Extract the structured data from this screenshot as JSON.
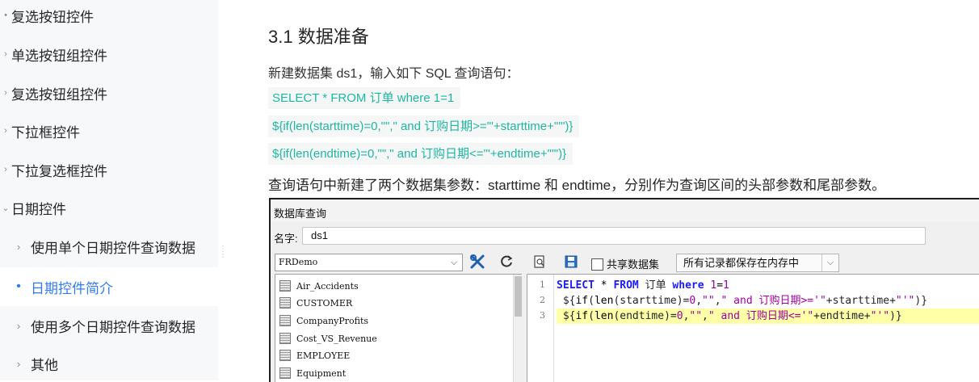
{
  "sidebar": {
    "items": [
      {
        "label": "复选按钮控件"
      },
      {
        "label": "单选按钮组控件"
      },
      {
        "label": "复选按钮组控件"
      },
      {
        "label": "下拉框控件"
      },
      {
        "label": "下拉复选框控件"
      },
      {
        "label": "日期控件"
      }
    ],
    "children": [
      {
        "label": "使用单个日期控件查询数据"
      },
      {
        "label": "日期控件简介"
      },
      {
        "label": "使用多个日期控件查询数据"
      },
      {
        "label": "其他"
      }
    ],
    "active_child": "日期控件简介"
  },
  "article": {
    "section_title": "3.1 数据准备",
    "intro": "新建数据集 ds1，输入如下 SQL 查询语句：",
    "code": [
      "SELECT * FROM 订单 where 1=1",
      " ${if(len(starttime)=0,\"\",\" and 订购日期>='\"+starttime+\"'\")}",
      " ${if(len(endtime)=0,\"\",\" and 订购日期<='\"+endtime+\"'\")}"
    ],
    "param_desc": "查询语句中新建了两个数据集参数：starttime 和 endtime，分别作为查询区间的头部参数和尾部参数。"
  },
  "dialog": {
    "title": "数据库查询",
    "name_label": "名字:",
    "name_value": "ds1",
    "datasource": "FRDemo",
    "tables": [
      "Air_Accidents",
      "CUSTOMER",
      "CompanyProfits",
      "Cost_VS_Revenue",
      "EMPLOYEE",
      "Equipment"
    ],
    "share_label": "共享数据集",
    "memory_option": "所有记录都保存在内存中",
    "line_numbers": [
      "1",
      "2",
      "3"
    ]
  }
}
